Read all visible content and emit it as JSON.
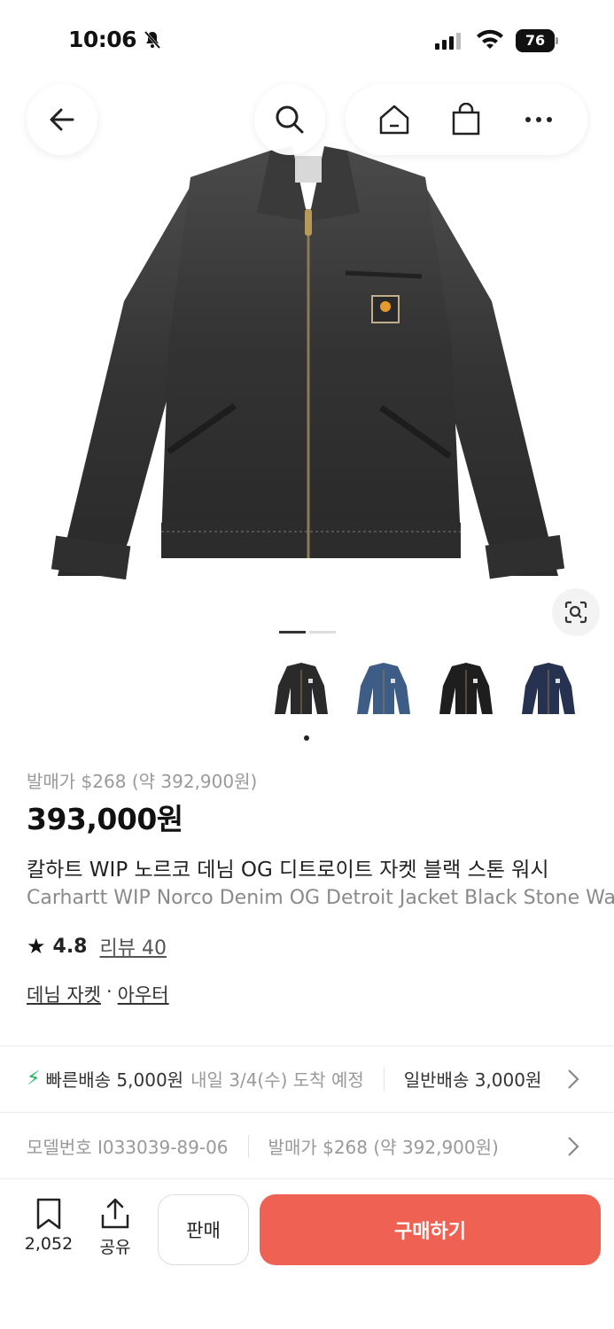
{
  "status_bar": {
    "time": "10:06",
    "battery": "76",
    "icons": [
      "bell-slash-icon",
      "signal-icon",
      "wifi-icon",
      "battery-icon"
    ]
  },
  "top_nav": {
    "back_icon": "arrow-left-icon",
    "search_icon": "search-icon",
    "home_icon": "home-icon",
    "bag_icon": "shopping-bag-icon",
    "more_icon": "more-dots-icon"
  },
  "gallery": {
    "image_count": 2,
    "active_index": 0,
    "thumbnails": [
      {
        "color": "#2a2a2a"
      },
      {
        "color": "#3d5d86"
      },
      {
        "color": "#1e1e1e"
      },
      {
        "color": "#26324f"
      }
    ]
  },
  "product": {
    "release_price": "발매가 $268 (약 392,900원)",
    "price": "393,000원",
    "title_ko": "칼하트 WIP 노르코 데님 OG 디트로이트 자켓 블랙 스톤 워시",
    "title_en": "Carhartt WIP Norco Denim OG Detroit Jacket Black Stone Washed",
    "rating": "4.8",
    "review_label": "리뷰 40",
    "category_primary": "데님 자켓",
    "category_sep": "·",
    "category_secondary": "아우터"
  },
  "shipping": {
    "fast_label": "빠른배송 5,000원",
    "fast_eta": "내일 3/4(수) 도착 예정",
    "standard_label": "일반배송 3,000원"
  },
  "model": {
    "model_label": "모델번호 I033039-89-06",
    "release_label": "발매가 $268 (약 392,900원)"
  },
  "bottom_bar": {
    "save_count": "2,052",
    "share_label": "공유",
    "sell_label": "판매",
    "buy_label": "구매하기"
  },
  "colors": {
    "buy_button": "#ef6253",
    "fast_shipping": "#22b35a"
  }
}
